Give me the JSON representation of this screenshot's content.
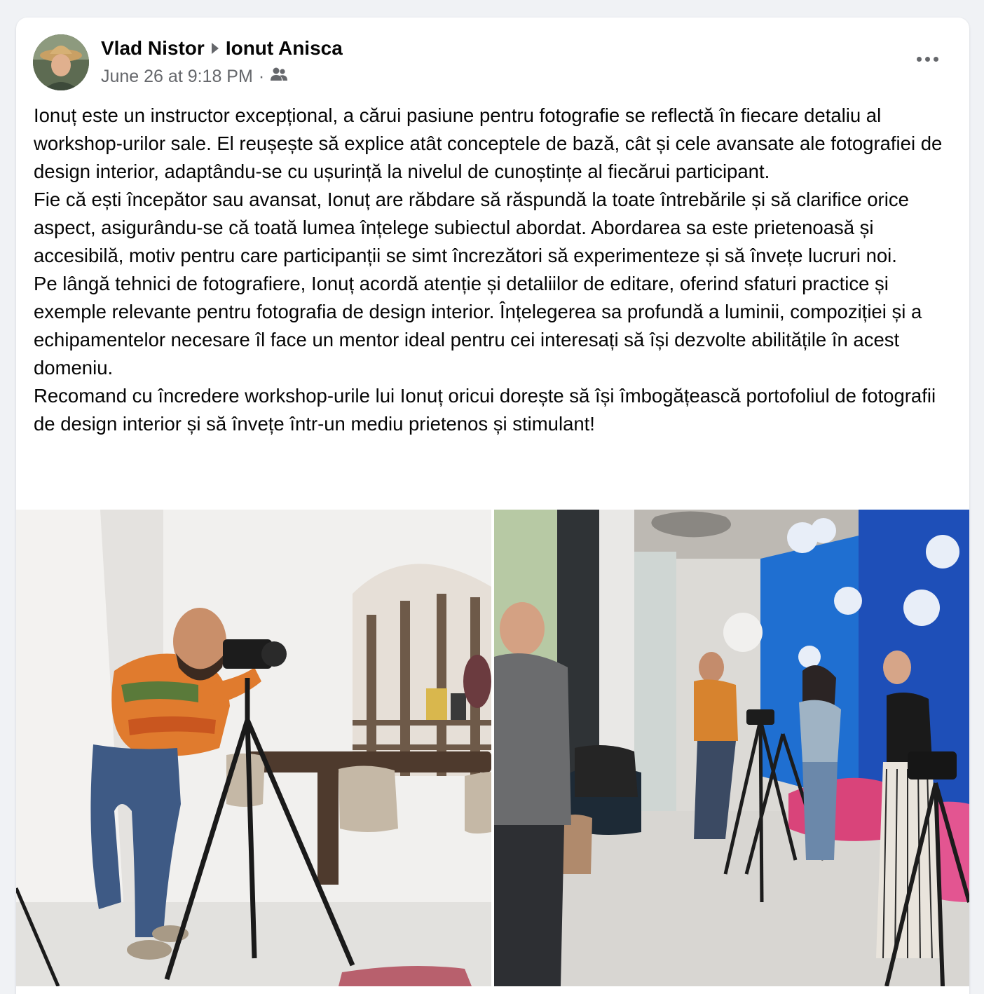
{
  "post": {
    "author": "Vlad Nistor",
    "recipient": "Ionut Anisca",
    "timestamp": "June 26 at 9:18 PM",
    "separator": "·",
    "audience_icon": "friends-icon",
    "more_icon": "more-horizontal-icon",
    "paragraphs": [
      "Ionuț este un instructor excepțional, a cărui pasiune  pentru fotografie se reflectă în fiecare detaliu al workshop-urilor sale. El reușește să explice atât conceptele de bază, cât și cele avansate ale fotografiei de design interior, adaptându-se cu ușurință la nivelul de cunoștințe al fiecărui participant.",
      "Fie că ești începător sau avansat, Ionuț are răbdare să răspundă la toate întrebările și să clarifice orice aspect, asigurându-se că toată lumea înțelege subiectul abordat. Abordarea sa este prietenoasă și accesibilă, motiv pentru care participanții se simt încrezători să experimenteze și să învețe lucruri noi.",
      "Pe lângă tehnici de fotografiere, Ionuț acordă atenție și detaliilor de editare, oferind sfaturi practice și exemple relevante pentru fotografia de design interior. Înțelegerea sa profundă a luminii, compoziției și a echipamentelor necesare îl face un mentor ideal pentru cei interesați să își dezvolte abilitățile în acest domeniu.",
      "Recomand cu încredere workshop-urile lui Ionuț oricui dorește să își îmbogățească portofoliul de fotografii de design interior și să învețe într-un mediu prietenos și stimulant!"
    ]
  },
  "colors": {
    "text": "#050505",
    "secondary_text": "#65676b",
    "card_bg": "#ffffff",
    "page_bg": "#f0f2f5"
  }
}
